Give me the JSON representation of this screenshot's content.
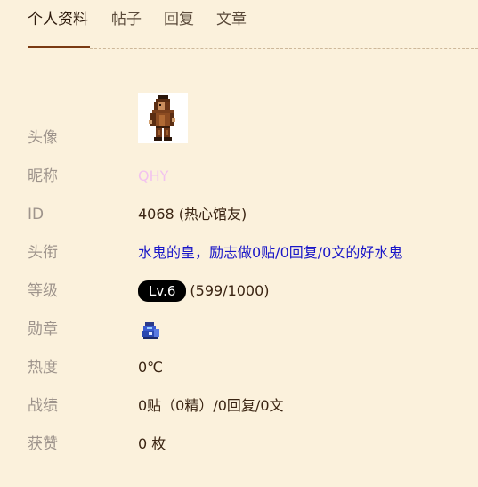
{
  "tabs": [
    {
      "label": "个人资料"
    },
    {
      "label": "帖子"
    },
    {
      "label": "回复"
    },
    {
      "label": "文章"
    }
  ],
  "profile": {
    "avatar": {
      "label": "头像",
      "icon": "pixel-character-avatar"
    },
    "nickname": {
      "label": "昵称",
      "value": "QHY",
      "color": "#f2c2ef"
    },
    "id": {
      "label": "ID",
      "value": "4068 (热心馆友)"
    },
    "title": {
      "label": "头衔",
      "value": "水鬼的皇，励志做0贴/0回复/0文的好水鬼",
      "color": "#1a17c8"
    },
    "level": {
      "label": "等级",
      "badge": "Lv.6",
      "exp": "(599/1000)"
    },
    "medal": {
      "label": "勋章",
      "icon": "blue-book-medal-icon"
    },
    "heat": {
      "label": "热度",
      "value": "0℃"
    },
    "record": {
      "label": "战绩",
      "value": "0贴（0精）/0回复/0文"
    },
    "likes": {
      "label": "获赞",
      "value": "0 枚"
    }
  },
  "colors": {
    "background": "#fbf1dc",
    "tab_underline": "#7a3a12",
    "label_text": "#9e948c"
  }
}
